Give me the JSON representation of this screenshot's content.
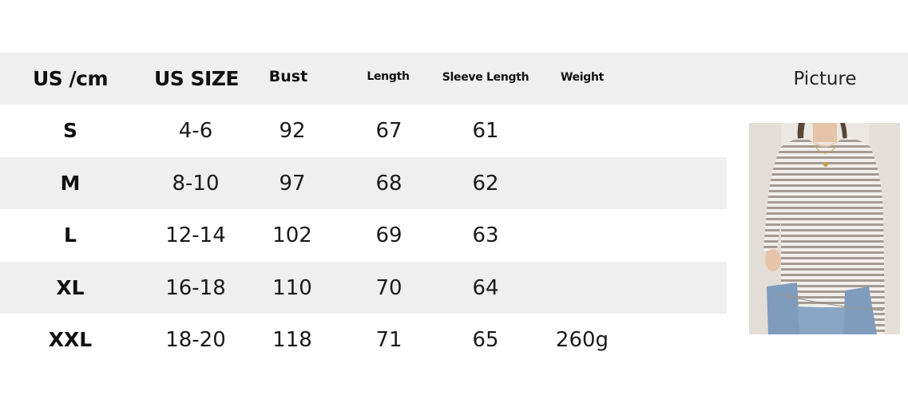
{
  "headers": {
    "us_cm": "US /cm",
    "us_size": "US SIZE",
    "bust": "Bust",
    "length": "Length",
    "sleeve_length": "Sleeve Length",
    "weight": "Weight",
    "picture": "Picture"
  },
  "rows": [
    {
      "size": "S",
      "us_size": "4-6",
      "bust": "92",
      "length": "67",
      "sleeve": "61",
      "weight": ""
    },
    {
      "size": "M",
      "us_size": "8-10",
      "bust": "97",
      "length": "68",
      "sleeve": "62",
      "weight": ""
    },
    {
      "size": "L",
      "us_size": "12-14",
      "bust": "102",
      "length": "69",
      "sleeve": "63",
      "weight": ""
    },
    {
      "size": "XL",
      "us_size": "16-18",
      "bust": "110",
      "length": "70",
      "sleeve": "64",
      "weight": ""
    },
    {
      "size": "XXL",
      "us_size": "18-20",
      "bust": "118",
      "length": "71",
      "sleeve": "65",
      "weight": "260g"
    }
  ],
  "colors": {
    "header_bg": "#efefef",
    "stripe_bg": "#efefef",
    "text": "#111111"
  },
  "icons": {
    "product_photo": "striped-long-sleeve-top-photo"
  }
}
